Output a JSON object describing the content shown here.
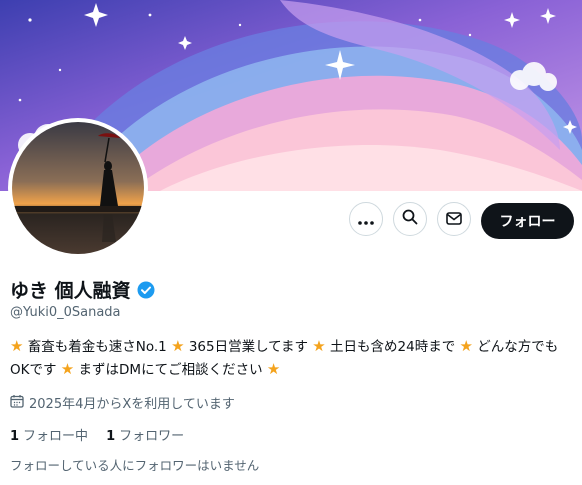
{
  "profile": {
    "name": "ゆき 個人融資",
    "handle": "@Yuki0_0Sanada",
    "bio_segments": [
      "畜査も着金も速さNo.1",
      "365日営業してます",
      "土日も含め24時まで",
      "どんな方でもOKです",
      "まずはDMにてご相談ください"
    ],
    "joined": "2025年4月からXを利用しています",
    "following_count": "1",
    "following_label": "フォロー中",
    "followers_count": "1",
    "followers_label": "フォロワー",
    "followed_by_text": "フォローしている人にフォロワーはいません"
  },
  "actions": {
    "follow_label": "フォロー"
  },
  "colors": {
    "follow_button": "#0f1419",
    "verified": "#1d9bf0",
    "secondary_text": "#536471"
  },
  "icons": {
    "more": "more-icon",
    "search": "search-icon",
    "message": "mail-icon",
    "calendar": "calendar-icon",
    "verified": "verified-badge-icon",
    "star": "star-icon"
  }
}
